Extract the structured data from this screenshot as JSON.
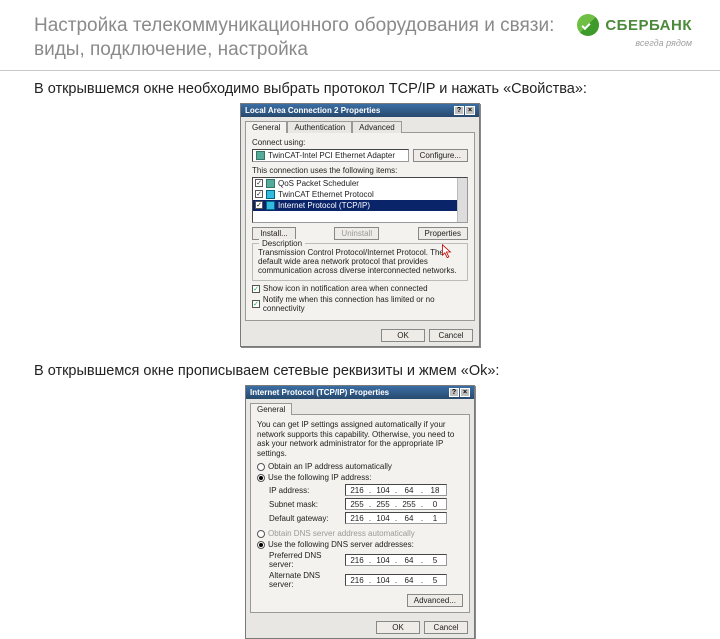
{
  "header": {
    "title": "Настройка телекоммуникационного оборудования и связи: виды, подключение, настройка",
    "logo_text": "СБЕРБАНК",
    "logo_tag": "всегда рядом"
  },
  "body": {
    "p1": "В открывшемся окне необходимо выбрать протокол TCP/IP и нажать «Свойства»:",
    "p2": "В открывшемся окне прописываем сетевые реквизиты и жмем «Ok»:"
  },
  "win1": {
    "title": "Local Area Connection 2 Properties",
    "tabs": [
      "General",
      "Authentication",
      "Advanced"
    ],
    "connect_using": "Connect using:",
    "adapter": "TwinCAT-Intel PCI Ethernet Adapter",
    "configure": "Configure...",
    "items_label": "This connection uses the following items:",
    "items": [
      {
        "name": "QoS Packet Scheduler",
        "checked": true
      },
      {
        "name": "TwinCAT Ethernet Protocol",
        "checked": true
      },
      {
        "name": "Internet Protocol (TCP/IP)",
        "checked": true,
        "selected": true
      }
    ],
    "install": "Install...",
    "uninstall": "Uninstall",
    "properties": "Properties",
    "desc_title": "Description",
    "desc": "Transmission Control Protocol/Internet Protocol. The default wide area network protocol that provides communication across diverse interconnected networks.",
    "chk1": "Show icon in notification area when connected",
    "chk2": "Notify me when this connection has limited or no connectivity",
    "ok": "OK",
    "cancel": "Cancel"
  },
  "win2": {
    "title": "Internet Protocol (TCP/IP) Properties",
    "tab": "General",
    "note": "You can get IP settings assigned automatically if your network supports this capability. Otherwise, you need to ask your network administrator for the appropriate IP settings.",
    "r1": "Obtain an IP address automatically",
    "r2": "Use the following IP address:",
    "ip_label": "IP address:",
    "ip": [
      "216",
      "104",
      "64",
      "18"
    ],
    "mask_label": "Subnet mask:",
    "mask": [
      "255",
      "255",
      "255",
      "0"
    ],
    "gw_label": "Default gateway:",
    "gw": [
      "216",
      "104",
      "64",
      "1"
    ],
    "r3": "Obtain DNS server address automatically",
    "r4": "Use the following DNS server addresses:",
    "pdns_label": "Preferred DNS server:",
    "pdns": [
      "216",
      "104",
      "64",
      "5"
    ],
    "adns_label": "Alternate DNS server:",
    "adns": [
      "216",
      "104",
      "64",
      "5"
    ],
    "advanced": "Advanced...",
    "ok": "OK",
    "cancel": "Cancel"
  }
}
